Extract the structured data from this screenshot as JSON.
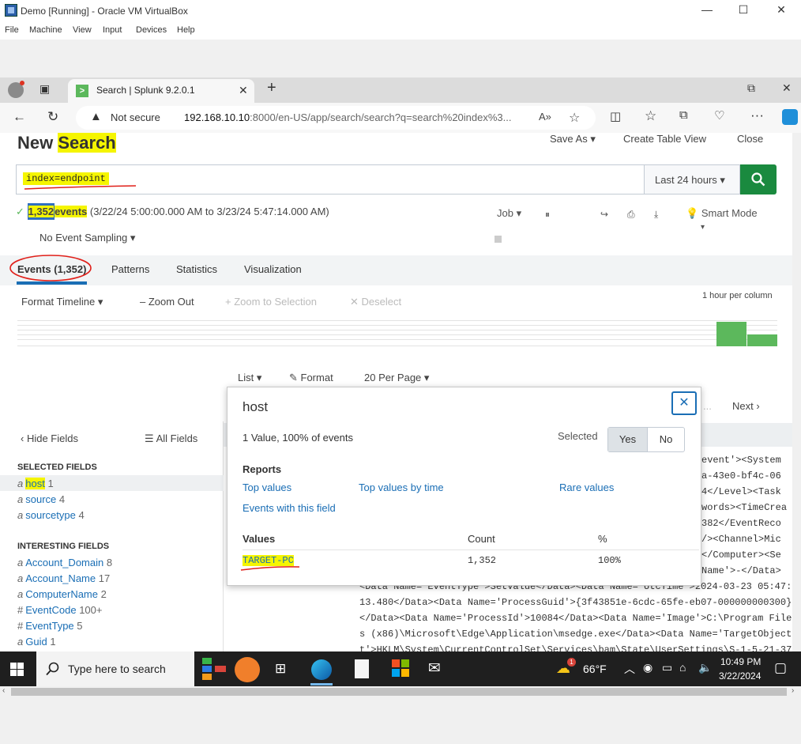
{
  "vbox": {
    "title": "Demo [Running] - Oracle VM VirtualBox",
    "menu": [
      "File",
      "Machine",
      "View",
      "Input",
      "Devices",
      "Help"
    ]
  },
  "browser": {
    "tab_title": "Search | Splunk 9.2.0.1",
    "not_secure": "Not secure",
    "url_host": "192.168.10.10",
    "url_rest": ":8000/en-US/app/search/search?q=search%20index%3..."
  },
  "splunk": {
    "title_prefix": "New ",
    "title_word": "Search",
    "save_as": "Save As",
    "create_table_view": "Create Table View",
    "close": "Close",
    "query": "index=endpoint",
    "time_range": "Last 24 hours",
    "event_count": "1,352",
    "events_word": "events",
    "time_span": "(3/22/24 5:00:00.000 AM to 3/23/24 5:47:14.000 AM)",
    "job": "Job",
    "smart_mode": "Smart Mode",
    "sampling": "No Event Sampling",
    "tabs": [
      "Events (1,352)",
      "Patterns",
      "Statistics",
      "Visualization"
    ],
    "timeline": {
      "format": "Format Timeline",
      "zoom_out": "Zoom Out",
      "zoom_sel": "Zoom to Selection",
      "deselect": "Deselect",
      "per_col": "1 hour per column"
    },
    "results_bar": {
      "list": "List",
      "format": "Format",
      "per_page": "20 Per Page",
      "next": "Next"
    },
    "sidebar": {
      "hide_fields": "Hide Fields",
      "all_fields": "All Fields",
      "selected_header": "SELECTED FIELDS",
      "selected": [
        {
          "type": "a",
          "name": "host",
          "count": "1"
        },
        {
          "type": "a",
          "name": "source",
          "count": "4"
        },
        {
          "type": "a",
          "name": "sourcetype",
          "count": "4"
        }
      ],
      "interesting_header": "INTERESTING FIELDS",
      "interesting": [
        {
          "type": "a",
          "name": "Account_Domain",
          "count": "8"
        },
        {
          "type": "a",
          "name": "Account_Name",
          "count": "17"
        },
        {
          "type": "a",
          "name": "ComputerName",
          "count": "2"
        },
        {
          "type": "#",
          "name": "EventCode",
          "count": "100+"
        },
        {
          "type": "#",
          "name": "EventType",
          "count": "5"
        },
        {
          "type": "a",
          "name": "Guid",
          "count": "1"
        }
      ]
    },
    "popup": {
      "title": "host",
      "summary": "1 Value, 100% of events",
      "selected_label": "Selected",
      "yes": "Yes",
      "no": "No",
      "reports": "Reports",
      "top_values": "Top values",
      "top_values_time": "Top values by time",
      "rare_values": "Rare values",
      "events_with_field": "Events with this field",
      "col_values": "Values",
      "col_count": "Count",
      "col_pct": "%",
      "row_value": "TARGET-PC",
      "row_count": "1,352",
      "row_pct": "100%"
    },
    "raw_right": [
      "event'><System",
      "a-43e0-bf4c-06",
      "4</Level><Task",
      "words><TimeCrea",
      "382</EventReco",
      "/><Channel>Mic",
      "</Computer><Se",
      "Name'>-</Data>"
    ],
    "raw_lines": [
      "<Data Name='EventType'>SetValue</Data><Data Name='UtcTime'>2024-03-23 05:47:",
      "13.480</Data><Data Name='ProcessGuid'>{3f43851e-6cdc-65fe-eb07-000000000300}",
      "</Data><Data Name='ProcessId'>10084</Data><Data Name='Image'>C:\\Program Files",
      "s (x86)\\Microsoft\\Edge\\Application\\msedge.exe</Data><Data Name='TargetObject",
      "t'>HKLM\\System\\CurrentControlSet\\Services\\bam\\State\\UserSettings\\S-1-5-21-37"
    ]
  },
  "taskbar": {
    "search_placeholder": "Type here to search",
    "temp": "66°F",
    "time": "10:49 PM",
    "date": "3/22/2024",
    "badge": "1"
  },
  "colors": {
    "splunk_green": "#1a8a3f",
    "link_blue": "#1a6eb5",
    "highlight": "#f5f500",
    "annotation_red": "#e0201a"
  }
}
